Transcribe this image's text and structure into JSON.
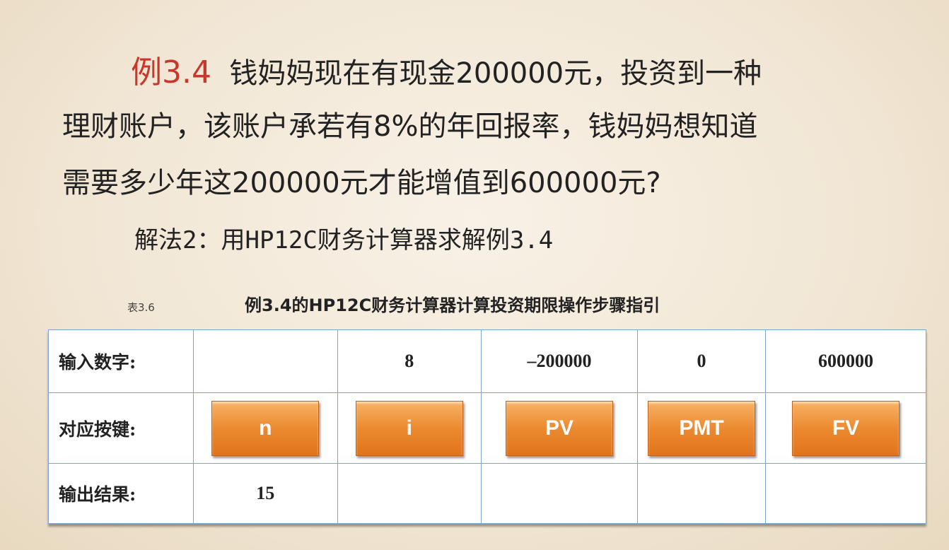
{
  "problem": {
    "label": "例3.4",
    "line1": "钱妈妈现在有现金200000元，投资到一种",
    "line2": "理财账户，该账户承若有8%的年回报率，钱妈妈想知道",
    "line3": "需要多少年这200000元才能增值到600000元?"
  },
  "solution_heading": "解法2：用HP12C财务计算器求解例3.4",
  "table": {
    "label": "表3.6",
    "title": "例3.4的HP12C财务计算器计算投资期限操作步骤指引",
    "rows": [
      {
        "header": "输入数字:",
        "cells": [
          "",
          "8",
          "–200000",
          "0",
          "600000"
        ]
      },
      {
        "header": "对应按键:",
        "cells": [
          "n",
          "i",
          "PV",
          "PMT",
          "FV"
        ]
      },
      {
        "header": "输出结果:",
        "cells": [
          "15",
          "",
          "",
          "",
          ""
        ]
      }
    ]
  }
}
